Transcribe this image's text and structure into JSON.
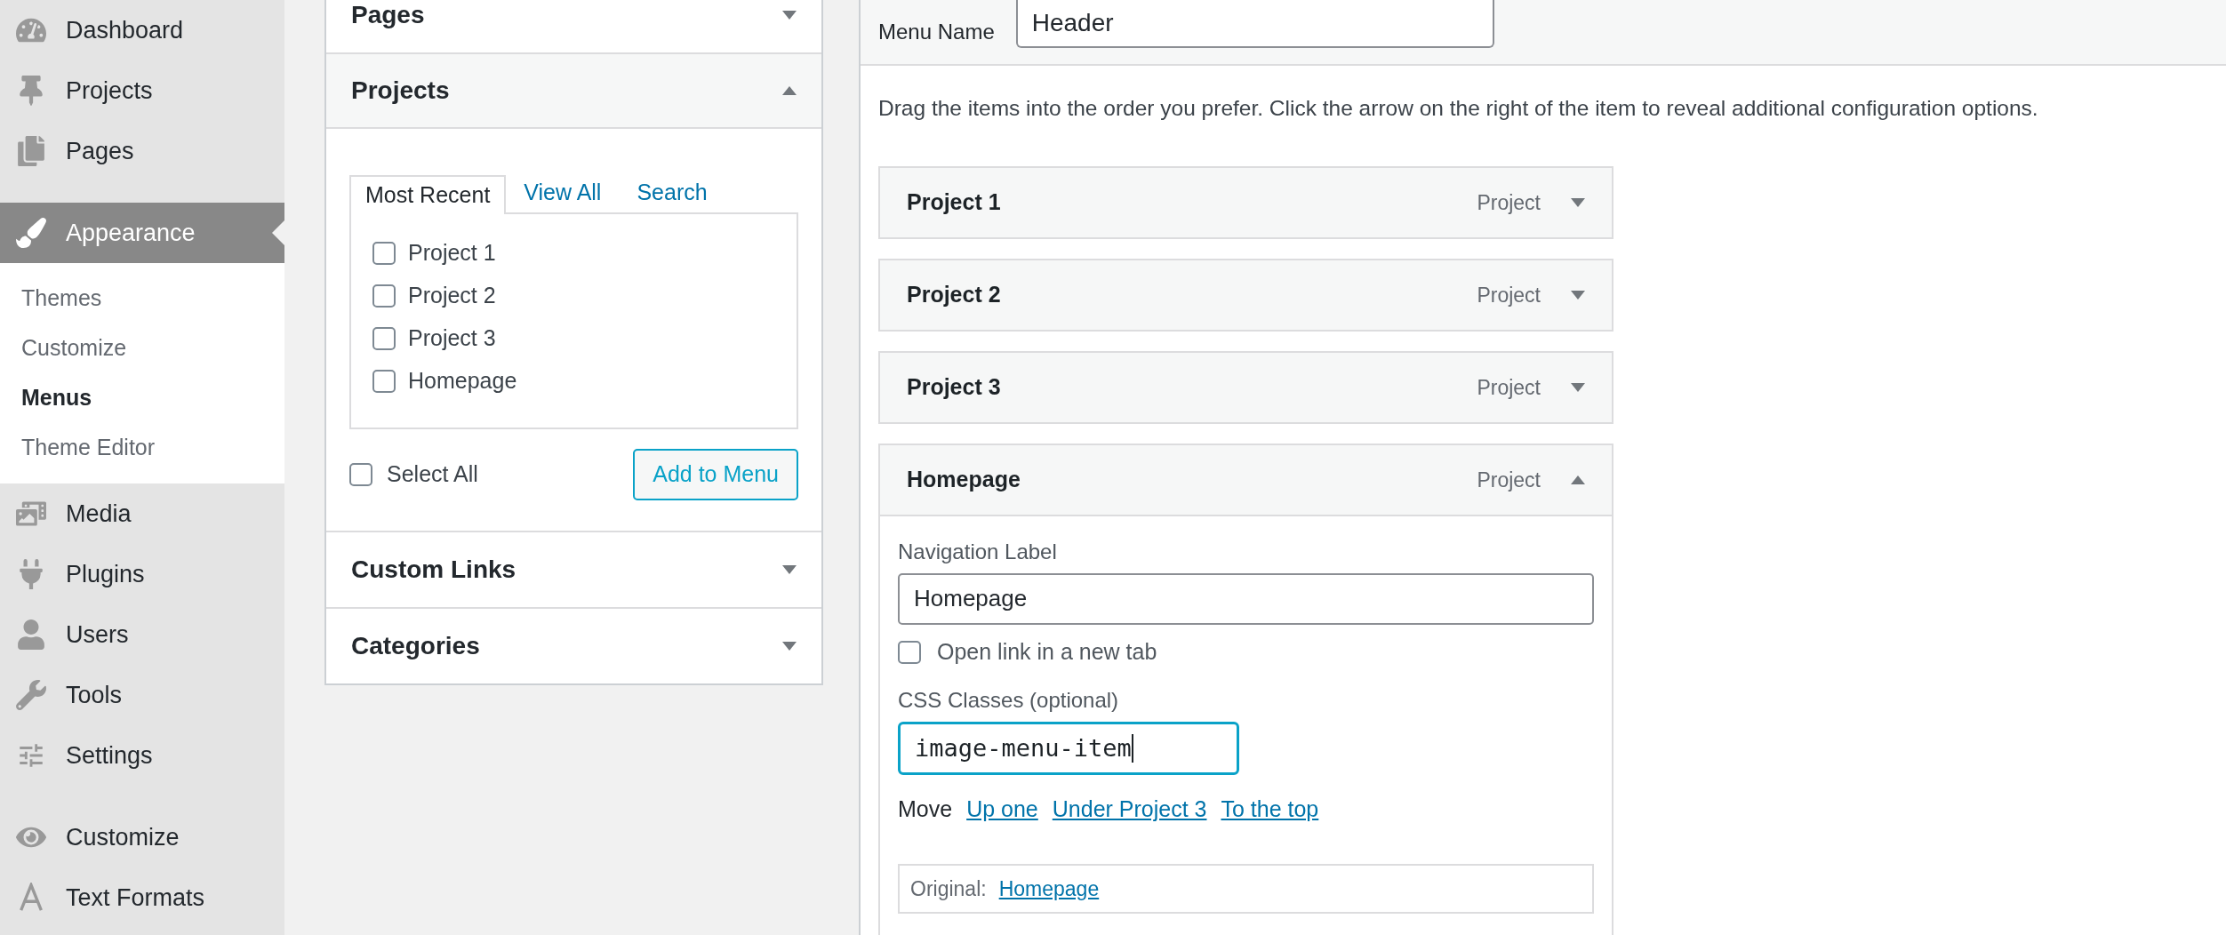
{
  "sidebar": {
    "groups": [
      [
        {
          "label": "Dashboard",
          "selected": false
        },
        {
          "label": "Projects",
          "selected": false
        },
        {
          "label": "Pages",
          "selected": false
        }
      ],
      [
        {
          "label": "Appearance",
          "selected": true,
          "children": [
            {
              "label": "Themes",
              "selected": false
            },
            {
              "label": "Customize",
              "selected": false
            },
            {
              "label": "Menus",
              "selected": true
            },
            {
              "label": "Theme Editor",
              "selected": false
            }
          ]
        },
        {
          "label": "Media",
          "selected": false
        },
        {
          "label": "Plugins",
          "selected": false
        },
        {
          "label": "Users",
          "selected": false
        },
        {
          "label": "Tools",
          "selected": false
        },
        {
          "label": "Settings",
          "selected": false
        }
      ],
      [
        {
          "label": "Customize",
          "selected": false
        },
        {
          "label": "Text Formats",
          "selected": false
        }
      ]
    ]
  },
  "accordion": [
    {
      "title": "Pages",
      "expanded": false
    },
    {
      "title": "Projects",
      "expanded": true,
      "tabs": [
        {
          "label": "Most Recent",
          "selected": true
        },
        {
          "label": "View All",
          "selected": false
        },
        {
          "label": "Search",
          "selected": false
        }
      ],
      "items": [
        {
          "label": "Project 1",
          "checked": false
        },
        {
          "label": "Project 2",
          "checked": false
        },
        {
          "label": "Project 3",
          "checked": false
        },
        {
          "label": "Homepage",
          "checked": false
        }
      ],
      "select_all": {
        "label": "Select All",
        "checked": false
      },
      "button": "Add to Menu"
    },
    {
      "title": "Custom Links",
      "expanded": false
    },
    {
      "title": "Categories",
      "expanded": false
    }
  ],
  "menu_name": {
    "label": "Menu Name",
    "value": "Header"
  },
  "instructions": "Drag the items into the order you prefer. Click the arrow on the right of the item to reveal additional configuration options.",
  "menu_items": [
    {
      "title": "Project 1",
      "type": "Project",
      "expanded": false
    },
    {
      "title": "Project 2",
      "type": "Project",
      "expanded": false
    },
    {
      "title": "Project 3",
      "type": "Project",
      "expanded": false
    },
    {
      "title": "Homepage",
      "type": "Project",
      "expanded": true,
      "settings": {
        "nav_label": {
          "label": "Navigation Label",
          "value": "Homepage"
        },
        "new_tab": {
          "label": "Open link in a new tab",
          "checked": false
        },
        "css_classes": {
          "label": "CSS Classes (optional)",
          "value": "image-menu-item",
          "focused": true
        },
        "move": {
          "label": "Move",
          "links": [
            "Up one",
            "Under Project 3",
            "To the top"
          ]
        },
        "original": {
          "label": "Original:",
          "link": "Homepage"
        }
      }
    }
  ]
}
